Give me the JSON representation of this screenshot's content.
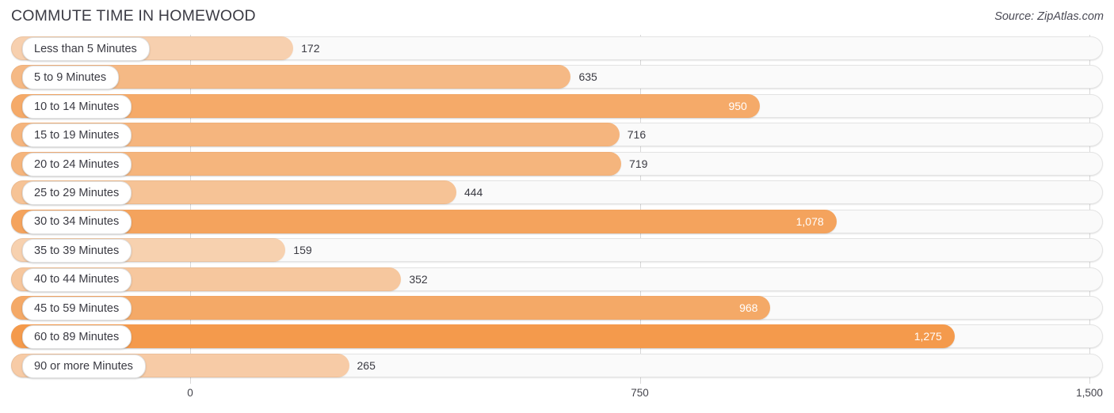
{
  "header": {
    "title": "COMMUTE TIME IN HOMEWOOD",
    "source": "Source: ZipAtlas.com"
  },
  "axis": {
    "ticks": [
      "0",
      "750",
      "1,500"
    ],
    "tick_values": [
      0,
      750,
      1500
    ],
    "min": 0,
    "max": 1500
  },
  "colors": {
    "bar_base": "#f49a4c",
    "track_fill": "#fafafa",
    "track_border": "#e3e3e3",
    "gridline": "#d8d8d8",
    "title_text": "#3b3b44",
    "value_text_outside": "#3a3a42",
    "value_text_inside": "#ffffff"
  },
  "chart_data": {
    "type": "bar",
    "orientation": "horizontal",
    "title": "COMMUTE TIME IN HOMEWOOD",
    "xlabel": "",
    "ylabel": "",
    "xlim": [
      0,
      1500
    ],
    "grid": true,
    "legend": false,
    "categories": [
      "Less than 5 Minutes",
      "5 to 9 Minutes",
      "10 to 14 Minutes",
      "15 to 19 Minutes",
      "20 to 24 Minutes",
      "25 to 29 Minutes",
      "30 to 34 Minutes",
      "35 to 39 Minutes",
      "40 to 44 Minutes",
      "45 to 59 Minutes",
      "60 to 89 Minutes",
      "90 or more Minutes"
    ],
    "values": [
      172,
      635,
      950,
      716,
      719,
      444,
      1078,
      159,
      352,
      968,
      1275,
      265
    ],
    "value_labels": [
      "172",
      "635",
      "950",
      "716",
      "719",
      "444",
      "1,078",
      "159",
      "352",
      "968",
      "1,275",
      "265"
    ]
  }
}
